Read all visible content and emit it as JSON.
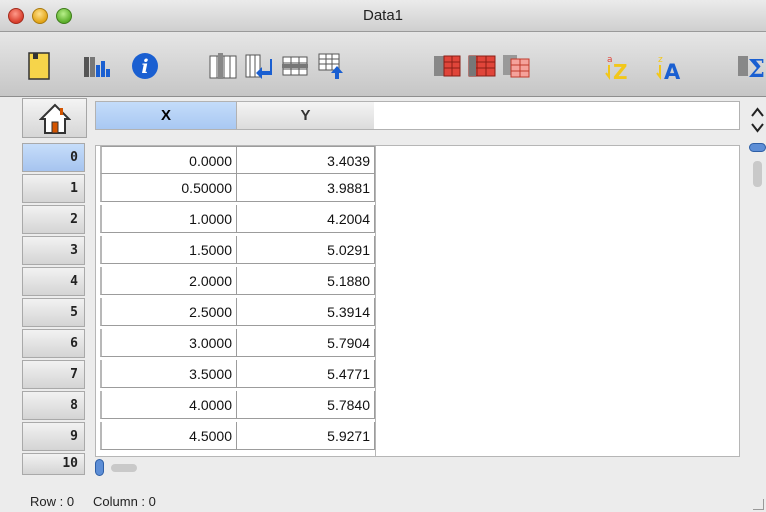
{
  "window": {
    "title": "Data1"
  },
  "toolbar": {
    "buttons": [
      "new-sheet-icon",
      "column-chart-icon",
      "info-icon",
      "insert-column-icon",
      "insert-row-icon",
      "delete-row-icon",
      "append-row-icon",
      "select-red-icon",
      "fill-red-icon",
      "clear-red-icon",
      "sort-descending-icon",
      "sort-ascending-icon",
      "sum-icon"
    ]
  },
  "colors": {
    "accent": "#a9c8f2",
    "icon_blue": "#1a5fd1",
    "icon_red": "#e0453a",
    "icon_yellow": "#f2c71a"
  },
  "columns": [
    {
      "label": "X"
    },
    {
      "label": "Y"
    }
  ],
  "rows": [
    {
      "index": "0",
      "x": "0.0000",
      "y": "3.4039"
    },
    {
      "index": "1",
      "x": "0.50000",
      "y": "3.9881"
    },
    {
      "index": "2",
      "x": "1.0000",
      "y": "4.2004"
    },
    {
      "index": "3",
      "x": "1.5000",
      "y": "5.0291"
    },
    {
      "index": "4",
      "x": "2.0000",
      "y": "5.1880"
    },
    {
      "index": "5",
      "x": "2.5000",
      "y": "5.3914"
    },
    {
      "index": "6",
      "x": "3.0000",
      "y": "5.7904"
    },
    {
      "index": "7",
      "x": "3.5000",
      "y": "5.4771"
    },
    {
      "index": "8",
      "x": "4.0000",
      "y": "5.7840"
    },
    {
      "index": "9",
      "x": "4.5000",
      "y": "5.9271"
    }
  ],
  "row_10_label": "10",
  "status": {
    "row_text": "Row : 0",
    "column_text": "Column : 0"
  }
}
